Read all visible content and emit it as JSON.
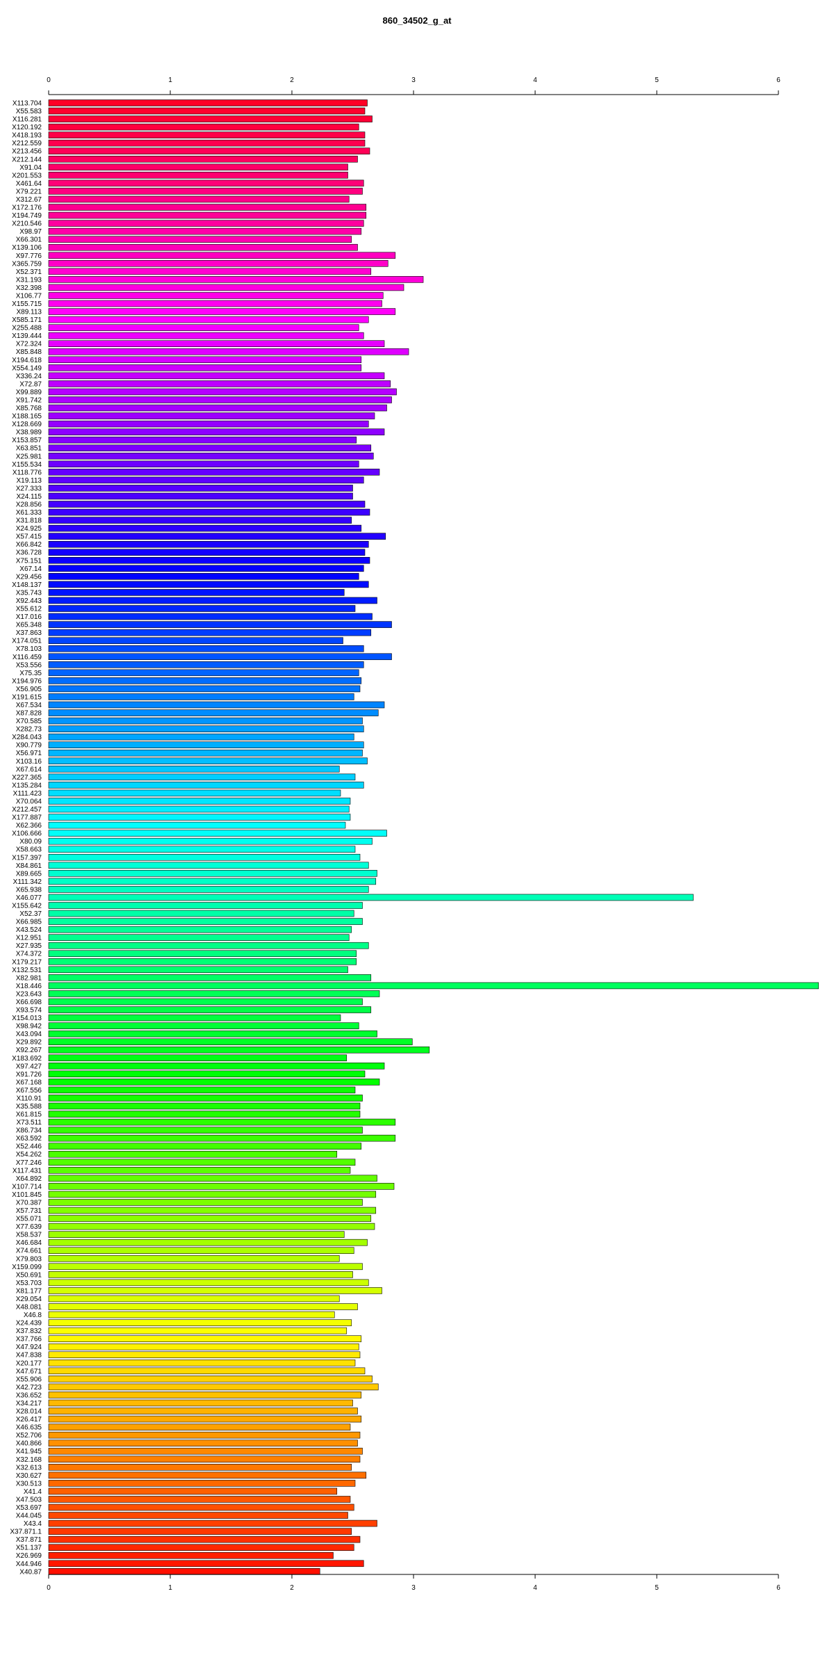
{
  "chart_data": {
    "type": "bar",
    "orientation": "horizontal",
    "title": "860_34502_g_at",
    "xlabel": "",
    "ylabel": "",
    "xlim": [
      0,
      6
    ],
    "ticks": [
      "0",
      "1",
      "2",
      "3",
      "4",
      "5",
      "6"
    ],
    "grid": false,
    "legend": "none",
    "bar_color_scheme": "rainbow",
    "bar_border_color": "#000000",
    "categories": [
      "X113.704",
      "X55.583",
      "X116.281",
      "X120.192",
      "X418.193",
      "X212.559",
      "X213.456",
      "X212.144",
      "X91.04",
      "X201.553",
      "X461.64",
      "X79.221",
      "X312.67",
      "X172.176",
      "X194.749",
      "X210.546",
      "X98.97",
      "X66.301",
      "X139.106",
      "X97.776",
      "X365.759",
      "X52.371",
      "X31.193",
      "X32.398",
      "X106.77",
      "X155.715",
      "X89.113",
      "X585.171",
      "X255.488",
      "X139.444",
      "X72.324",
      "X85.848",
      "X194.618",
      "X554.149",
      "X336.24",
      "X72.87",
      "X99.889",
      "X91.742",
      "X85.768",
      "X188.165",
      "X128.669",
      "X38.989",
      "X153.857",
      "X63.851",
      "X25.981",
      "X155.534",
      "X118.776",
      "X19.113",
      "X27.333",
      "X24.115",
      "X28.856",
      "X61.333",
      "X31.818",
      "X24.925",
      "X57.415",
      "X66.842",
      "X36.728",
      "X75.151",
      "X67.14",
      "X29.456",
      "X148.137",
      "X35.743",
      "X92.443",
      "X55.612",
      "X17.016",
      "X65.348",
      "X37.863",
      "X174.051",
      "X78.103",
      "X116.459",
      "X53.556",
      "X75.35",
      "X194.976",
      "X56.905",
      "X191.615",
      "X67.534",
      "X87.828",
      "X70.585",
      "X282.73",
      "X284.043",
      "X90.779",
      "X56.971",
      "X103.16",
      "X67.614",
      "X227.365",
      "X135.284",
      "X111.423",
      "X70.064",
      "X212.457",
      "X177.887",
      "X62.366",
      "X106.666",
      "X80.09",
      "X58.663",
      "X157.397",
      "X84.861",
      "X89.665",
      "X111.342",
      "X65.938",
      "X46.077",
      "X155.642",
      "X52.37",
      "X66.985",
      "X43.524",
      "X12.951",
      "X27.935",
      "X74.372",
      "X179.217",
      "X132.531",
      "X82.981",
      "X18.446",
      "X23.643",
      "X66.698",
      "X93.574",
      "X154.013",
      "X98.942",
      "X43.094",
      "X29.892",
      "X92.267",
      "X183.692",
      "X97.427",
      "X91.726",
      "X67.168",
      "X67.556",
      "X110.91",
      "X35.588",
      "X61.815",
      "X73.511",
      "X86.734",
      "X63.592",
      "X52.446",
      "X54.262",
      "X77.246",
      "X117.431",
      "X64.892",
      "X107.714",
      "X101.845",
      "X70.387",
      "X57.731",
      "X55.071",
      "X77.639",
      "X58.537",
      "X46.684",
      "X74.661",
      "X79.803",
      "X159.099",
      "X50.691",
      "X53.703",
      "X81.177",
      "X29.054",
      "X48.081",
      "X46.8",
      "X24.439",
      "X37.832",
      "X37.766",
      "X47.924",
      "X47.838",
      "X20.177",
      "X47.671",
      "X55.906",
      "X42.723",
      "X36.652",
      "X34.217",
      "X28.014",
      "X26.417",
      "X46.635",
      "X52.706",
      "X40.866",
      "X41.945",
      "X32.168",
      "X32.613",
      "X30.627",
      "X30.513",
      "X41.4",
      "X47.503",
      "X53.697",
      "X44.045",
      "X43.4",
      "X37.871.1",
      "X37.871",
      "X51.137",
      "X26.969",
      "X44.946",
      "X40.87"
    ],
    "values": [
      2.62,
      2.6,
      2.66,
      2.55,
      2.6,
      2.6,
      2.64,
      2.54,
      2.46,
      2.46,
      2.59,
      2.58,
      2.47,
      2.61,
      2.61,
      2.59,
      2.57,
      2.49,
      2.54,
      2.85,
      2.79,
      2.65,
      3.08,
      2.92,
      2.75,
      2.74,
      2.85,
      2.63,
      2.55,
      2.59,
      2.76,
      2.96,
      2.57,
      2.57,
      2.76,
      2.81,
      2.86,
      2.82,
      2.78,
      2.68,
      2.63,
      2.76,
      2.53,
      2.65,
      2.67,
      2.55,
      2.72,
      2.59,
      2.5,
      2.5,
      2.6,
      2.64,
      2.49,
      2.57,
      2.77,
      2.63,
      2.6,
      2.64,
      2.59,
      2.55,
      2.63,
      2.43,
      2.7,
      2.52,
      2.66,
      2.82,
      2.65,
      2.42,
      2.59,
      2.82,
      2.59,
      2.55,
      2.57,
      2.56,
      2.51,
      2.76,
      2.71,
      2.58,
      2.59,
      2.51,
      2.59,
      2.58,
      2.62,
      2.39,
      2.52,
      2.59,
      2.4,
      2.48,
      2.47,
      2.48,
      2.44,
      2.78,
      2.66,
      2.52,
      2.56,
      2.63,
      2.7,
      2.69,
      2.63,
      5.3,
      2.58,
      2.51,
      2.58,
      2.49,
      2.47,
      2.63,
      2.53,
      2.53,
      2.46,
      2.65,
      6.33,
      2.72,
      2.58,
      2.65,
      2.4,
      2.55,
      2.7,
      2.99,
      3.13,
      2.45,
      2.76,
      2.6,
      2.72,
      2.52,
      2.58,
      2.56,
      2.56,
      2.85,
      2.58,
      2.85,
      2.57,
      2.37,
      2.52,
      2.48,
      2.7,
      2.84,
      2.69,
      2.58,
      2.69,
      2.65,
      2.68,
      2.43,
      2.62,
      2.51,
      2.39,
      2.58,
      2.5,
      2.63,
      2.74,
      2.39,
      2.54,
      2.35,
      2.49,
      2.45,
      2.57,
      2.55,
      2.56,
      2.52,
      2.6,
      2.66,
      2.71,
      2.57,
      2.5,
      2.54,
      2.57,
      2.48,
      2.56,
      2.54,
      2.58,
      2.56,
      2.49,
      2.61,
      2.52,
      2.37,
      2.48,
      2.51,
      2.46,
      2.7,
      2.49,
      2.56,
      2.51,
      2.34,
      2.59,
      2.23
    ]
  }
}
